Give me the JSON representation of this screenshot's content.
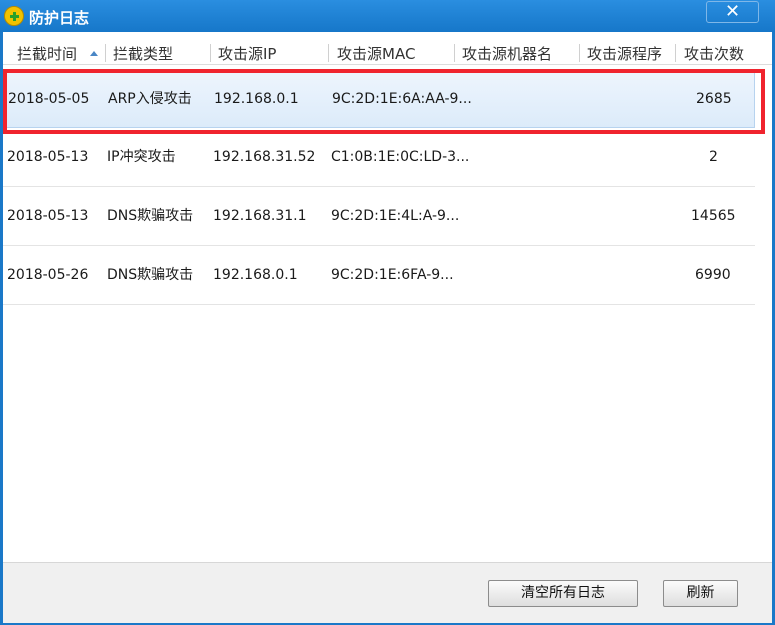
{
  "window": {
    "title": "防护日志",
    "close_glyph": "✕"
  },
  "columns": [
    "拦截时间",
    "拦截类型",
    "攻击源IP",
    "攻击源MAC",
    "攻击源机器名",
    "攻击源程序",
    "攻击次数"
  ],
  "rows": [
    {
      "time": "2018-05-05",
      "type": "ARP入侵攻击",
      "ip": "192.168.0.1",
      "mac": "9C:2D:1E:6A:AA-9...",
      "machine": "",
      "program": "",
      "count": "2685",
      "selected": true
    },
    {
      "time": "2018-05-13",
      "type": "IP冲突攻击",
      "ip": "192.168.31.52",
      "mac": "C1:0B:1E:0C:LD-3...",
      "machine": "",
      "program": "",
      "count": "2"
    },
    {
      "time": "2018-05-13",
      "type": "DNS欺骗攻击",
      "ip": "192.168.31.1",
      "mac": "9C:2D:1E:4L:A-9...",
      "machine": "",
      "program": "",
      "count": "14565"
    },
    {
      "time": "2018-05-26",
      "type": "DNS欺骗攻击",
      "ip": "192.168.0.1",
      "mac": "9C:2D:1E:6FA-9...",
      "machine": "",
      "program": "",
      "count": "6990"
    }
  ],
  "buttons": {
    "clear": "清空所有日志",
    "refresh": "刷新"
  },
  "colors": {
    "titlebar": "#1677c9",
    "highlight": "#f0242e",
    "selection": "#dcebfa"
  }
}
